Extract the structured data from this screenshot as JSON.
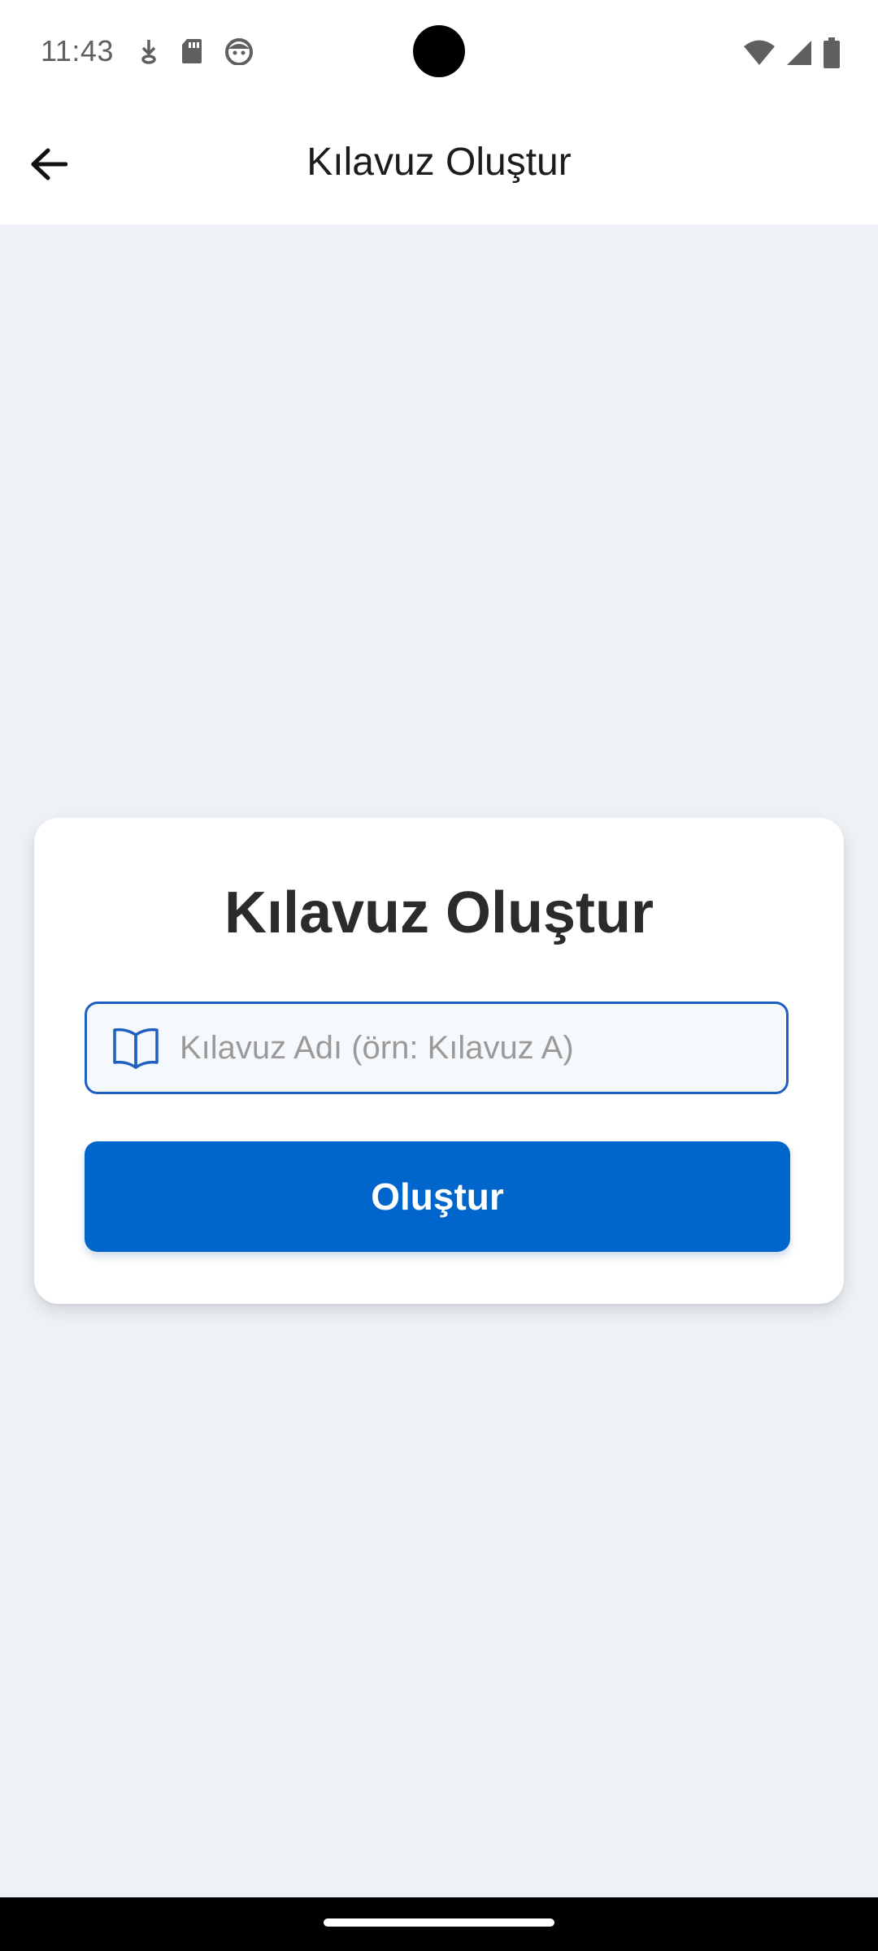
{
  "status_bar": {
    "time": "11:43",
    "left_icons": [
      "download-icon",
      "sd-card-icon",
      "android-head-icon"
    ],
    "right_icons": [
      "wifi-icon",
      "signal-icon",
      "battery-icon"
    ]
  },
  "app_bar": {
    "back_icon": "arrow-back-icon",
    "title": "Kılavuz Oluştur"
  },
  "card": {
    "title": "Kılavuz Oluştur",
    "input": {
      "icon": "book-open-icon",
      "value": "",
      "placeholder": "Kılavuz Adı (örn: Kılavuz A)"
    },
    "button_label": "Oluştur"
  },
  "colors": {
    "accent": "#0066cc",
    "input_border": "#1f5fbf",
    "background": "#eef2f6"
  }
}
